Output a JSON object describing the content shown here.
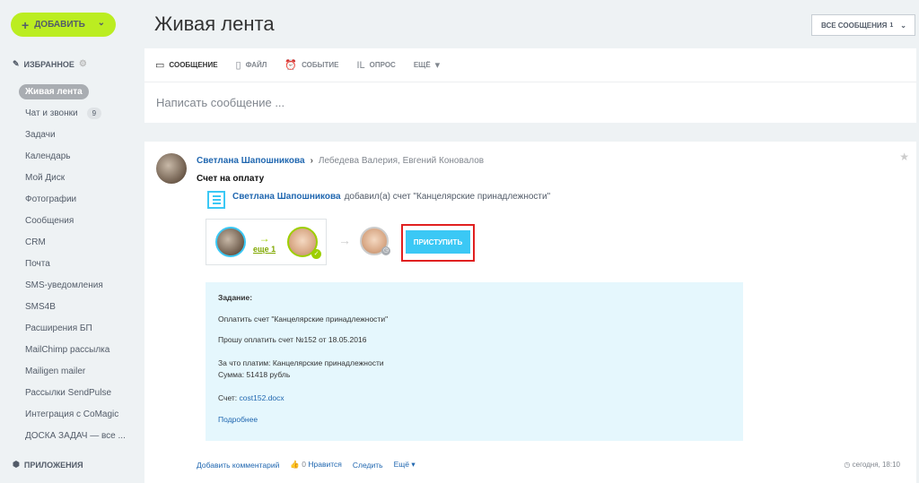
{
  "sidebar": {
    "add_label": "ДОБАВИТЬ",
    "favorites_label": "ИЗБРАННОЕ",
    "items": [
      {
        "label": "Живая лента",
        "active": true
      },
      {
        "label": "Чат и звонки",
        "badge": "9"
      },
      {
        "label": "Задачи"
      },
      {
        "label": "Календарь"
      },
      {
        "label": "Мой Диск"
      },
      {
        "label": "Фотографии"
      },
      {
        "label": "Сообщения"
      },
      {
        "label": "CRM"
      },
      {
        "label": "Почта"
      },
      {
        "label": "SMS-уведомления"
      },
      {
        "label": "SMS4B"
      },
      {
        "label": "Расширения БП"
      },
      {
        "label": "MailChimp рассылка"
      },
      {
        "label": "Mailigen mailer"
      },
      {
        "label": "Рассылки SendPulse"
      },
      {
        "label": "Интеграция с CoMagic"
      },
      {
        "label": "ДОСКА ЗАДАЧ — все ..."
      }
    ],
    "apps_label": "ПРИЛОЖЕНИЯ"
  },
  "header": {
    "title": "Живая лента",
    "filter_label": "ВСЕ СООБЩЕНИЯ",
    "filter_count": "1"
  },
  "composer": {
    "tabs": [
      {
        "label": "СООБЩЕНИЕ",
        "icon": "message-icon",
        "glyph": "▭"
      },
      {
        "label": "ФАЙЛ",
        "icon": "file-icon",
        "glyph": "▯"
      },
      {
        "label": "СОБЫТИЕ",
        "icon": "alarm-icon",
        "glyph": "⏰"
      },
      {
        "label": "ОПРОС",
        "icon": "poll-icon",
        "glyph": "ıl"
      },
      {
        "label": "ЕЩЁ",
        "icon": "chevron-down-icon",
        "glyph": "▾"
      }
    ],
    "placeholder": "Написать сообщение ..."
  },
  "post": {
    "author": "Светлана Шапошникова",
    "recipients": "Лебедева Валерия, Евгений Коновалов",
    "title": "Счет на оплату",
    "action_author": "Светлана Шапошникова",
    "action_text": "добавил(а) счет \"Канцелярские принадлежности\"",
    "workflow_more": "еще 1",
    "start_label": "ПРИСТУПИТЬ",
    "task": {
      "heading": "Задание:",
      "line1": "Оплатить счет \"Канцелярские принадлежности\"",
      "line2": "Прошу оплатить счет №152 от 18.05.2016",
      "line3": "За что платим: Канцелярские принадлежности",
      "line4": "Сумма: 51418 рубль",
      "invoice_label": "Счет:",
      "invoice_file": "cost152.docx",
      "more": "Подробнее"
    },
    "footer": {
      "comment": "Добавить комментарий",
      "likes": "0",
      "like_label": "Нравится",
      "follow": "Следить",
      "more": "Ещё"
    },
    "timestamp": "сегодня, 18:10"
  }
}
